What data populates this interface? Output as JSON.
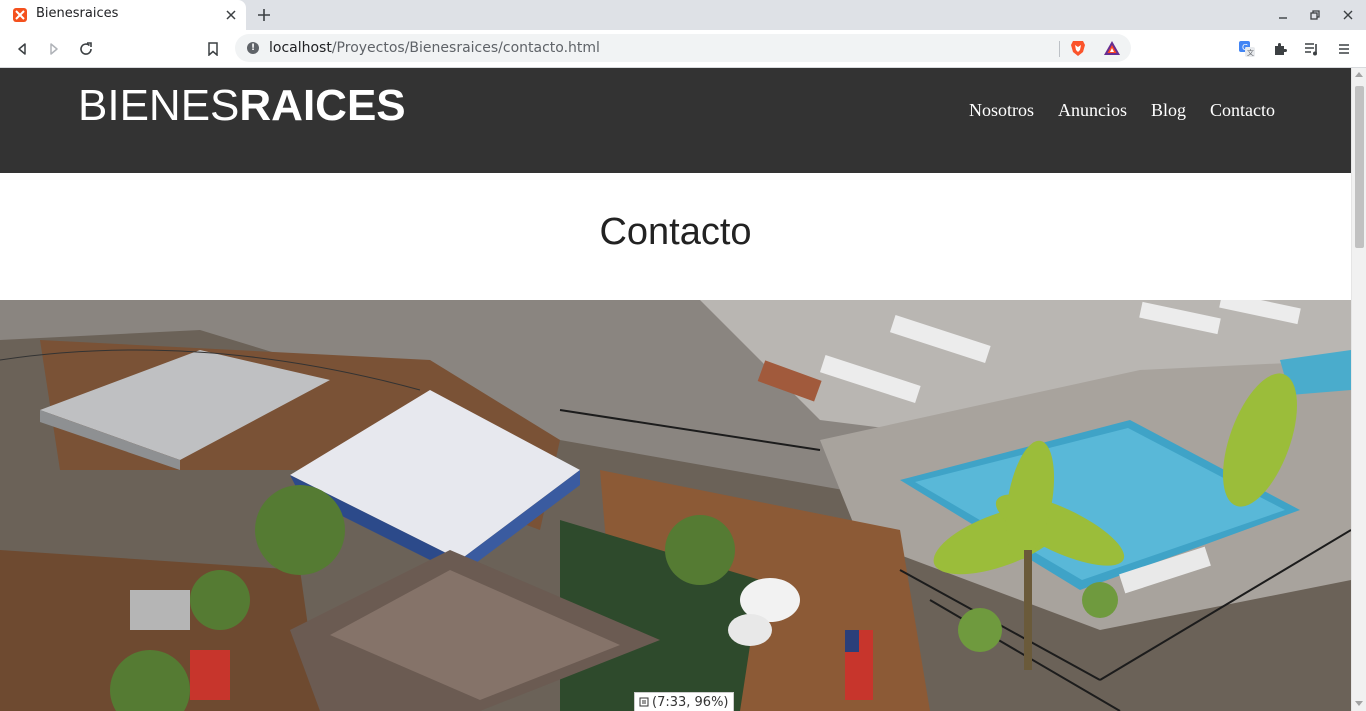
{
  "browser": {
    "tab_title": "Bienesraices",
    "url_host": "localhost",
    "url_path": "/Proyectos/Bienesraices/contacto.html",
    "status_text": "(7:33, 96%)"
  },
  "site": {
    "logo_thin": "BIENES",
    "logo_bold": "RAICES",
    "nav": [
      "Nosotros",
      "Anuncios",
      "Blog",
      "Contacto"
    ],
    "page_title": "Contacto"
  },
  "colors": {
    "header_bg": "#333333",
    "tab_strip": "#dee1e6",
    "pool": "#3fa3c7"
  }
}
